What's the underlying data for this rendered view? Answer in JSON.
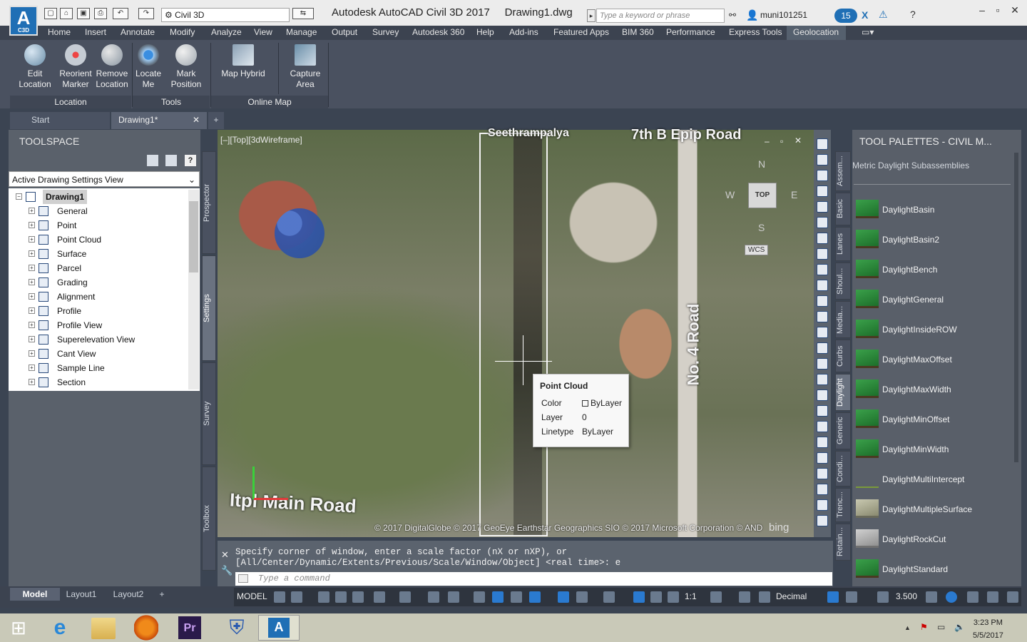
{
  "titlebar": {
    "app_logo": "A",
    "app_logo_sub": "C3D",
    "workspace": "Civil 3D",
    "title": "Autodesk AutoCAD Civil 3D 2017",
    "filename": "Drawing1.dwg",
    "search_placeholder": "Type a keyword or phrase",
    "user": "muni101251",
    "notifications": "15"
  },
  "menu": [
    "Home",
    "Insert",
    "Annotate",
    "Modify",
    "Analyze",
    "View",
    "Manage",
    "Output",
    "Survey",
    "Autodesk 360",
    "Help",
    "Add-ins",
    "Featured Apps",
    "BIM 360",
    "Performance",
    "Express Tools",
    "Geolocation"
  ],
  "menu_active": "Geolocation",
  "ribbon": {
    "buttons": [
      {
        "label1": "Edit",
        "label2": "Location"
      },
      {
        "label1": "Reorient",
        "label2": "Marker"
      },
      {
        "label1": "Remove",
        "label2": "Location"
      },
      {
        "label1": "Locate",
        "label2": "Me"
      },
      {
        "label1": "Mark",
        "label2": "Position"
      },
      {
        "label1": "Map Hybrid",
        "label2": ""
      },
      {
        "label1": "Capture",
        "label2": "Area"
      }
    ],
    "groups": [
      "Location",
      "Tools",
      "Online Map"
    ]
  },
  "doc_tabs": [
    "Start",
    "Drawing1*"
  ],
  "toolspace": {
    "title": "TOOLSPACE",
    "view": "Active Drawing Settings View",
    "side_tabs": [
      "Prospector",
      "Settings",
      "Survey",
      "Toolbox"
    ],
    "root": "Drawing1",
    "items": [
      "General",
      "Point",
      "Point Cloud",
      "Surface",
      "Parcel",
      "Grading",
      "Alignment",
      "Profile",
      "Profile View",
      "Superelevation View",
      "Cant View",
      "Sample Line",
      "Section"
    ]
  },
  "viewport": {
    "label": "[–][Top][3dWireframe]",
    "map_labels": {
      "area": "Seethrampalya",
      "road_top": "7th B Epip Road",
      "road_vertical": "No. 4 Road",
      "road_bottom": "Itpl Main Road"
    },
    "copyright": "© 2017 DigitalGlobe © 2017 GeoEye Earthstar Geographics SIO © 2017 Microsoft Corporation © AND",
    "bing": "bing",
    "viewcube": {
      "top": "TOP",
      "n": "N",
      "s": "S",
      "e": "E",
      "w": "W",
      "wcs": "WCS"
    }
  },
  "tooltip": {
    "title": "Point Cloud",
    "rows": [
      {
        "key": "Color",
        "value": "ByLayer"
      },
      {
        "key": "Layer",
        "value": "0"
      },
      {
        "key": "Linetype",
        "value": "ByLayer"
      }
    ]
  },
  "command": {
    "line1": "Specify corner of window, enter a scale factor (nX or nXP), or",
    "line2": "[All/Center/Dynamic/Extents/Previous/Scale/Window/Object] <real time>: e",
    "placeholder": "Type a command"
  },
  "tool_palettes": {
    "title": "TOOL PALETTES - CIVIL M...",
    "subtitle": "Metric Daylight Subassemblies",
    "side_tabs": [
      "Assem...",
      "Basic",
      "Lanes",
      "Shoul...",
      "Media...",
      "Curbs",
      "Daylight",
      "Generic",
      "Condi...",
      "Trenc...",
      "Retain..."
    ],
    "active_tab": "Daylight",
    "items": [
      "DaylightBasin",
      "DaylightBasin2",
      "DaylightBench",
      "DaylightGeneral",
      "DaylightInsideROW",
      "DaylightMaxOffset",
      "DaylightMaxWidth",
      "DaylightMinOffset",
      "DaylightMinWidth",
      "DaylightMultiIntercept",
      "DaylightMultipleSurface",
      "DaylightRockCut",
      "DaylightStandard"
    ]
  },
  "statusbar": {
    "layout_tabs": [
      "Model",
      "Layout1",
      "Layout2"
    ],
    "model": "MODEL",
    "scale": "1:1",
    "units": "Decimal",
    "value": "3.500"
  },
  "taskbar": {
    "time": "3:23 PM",
    "date": "5/5/2017"
  }
}
